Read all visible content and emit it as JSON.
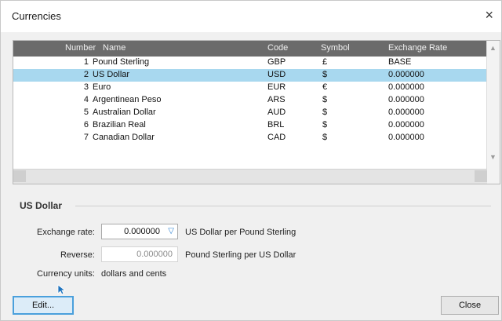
{
  "window": {
    "title": "Currencies",
    "close_glyph": "×"
  },
  "grid": {
    "headers": {
      "number": "Number",
      "name": "Name",
      "code": "Code",
      "symbol": "Symbol",
      "rate": "Exchange Rate"
    },
    "rows": [
      {
        "number": "1",
        "name": "Pound Sterling",
        "code": "GBP",
        "symbol": "£",
        "rate": "BASE"
      },
      {
        "number": "2",
        "name": "US Dollar",
        "code": "USD",
        "symbol": "$",
        "rate": "0.000000"
      },
      {
        "number": "3",
        "name": "Euro",
        "code": "EUR",
        "symbol": "€",
        "rate": "0.000000"
      },
      {
        "number": "4",
        "name": "Argentinean Peso",
        "code": "ARS",
        "symbol": "$",
        "rate": "0.000000"
      },
      {
        "number": "5",
        "name": "Australian Dollar",
        "code": "AUD",
        "symbol": "$",
        "rate": "0.000000"
      },
      {
        "number": "6",
        "name": "Brazilian Real",
        "code": "BRL",
        "symbol": "$",
        "rate": "0.000000"
      },
      {
        "number": "7",
        "name": "Canadian Dollar",
        "code": "CAD",
        "symbol": "$",
        "rate": "0.000000"
      }
    ],
    "selected_row": 1
  },
  "details": {
    "title": "US Dollar",
    "exchange_rate_label": "Exchange rate:",
    "exchange_rate_value": "0.000000",
    "exchange_rate_desc": "US Dollar per Pound Sterling",
    "reverse_label": "Reverse:",
    "reverse_value": "0.000000",
    "reverse_desc": "Pound Sterling per US Dollar",
    "units_label": "Currency units:",
    "units_value": "dollars and cents"
  },
  "buttons": {
    "edit": "Edit...",
    "close": "Close"
  },
  "colors": {
    "header_bg": "#6b6b6b",
    "selected_bg": "#a8d8ef",
    "accent": "#4aa0dc"
  }
}
